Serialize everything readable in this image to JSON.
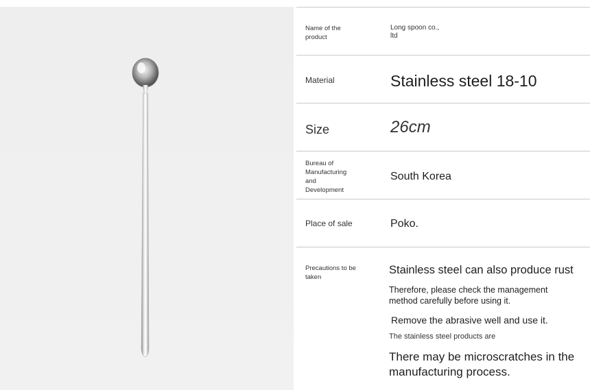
{
  "spec_rows": [
    {
      "label": "Name of the product",
      "value": "Long spoon co., ltd"
    },
    {
      "label": "Material",
      "value": "Stainless steel 18-10"
    },
    {
      "label": "Size",
      "value": "26cm"
    },
    {
      "label": "Bureau of Manufacturing and Development",
      "value": "South Korea"
    },
    {
      "label": "Place of sale",
      "value": "Poko."
    }
  ],
  "precautions": {
    "label": "Precautions to be taken",
    "lines": [
      "Stainless steel can also produce rust",
      "Therefore, please check the management method carefully before using it.",
      "Remove the abrasive well and use it.",
      "The stainless steel products are",
      "There may be microscratches in the manufacturing process."
    ]
  },
  "colors": {
    "photo_background": "#efefef",
    "divider": "#c9c9c9",
    "text": "#222222"
  }
}
